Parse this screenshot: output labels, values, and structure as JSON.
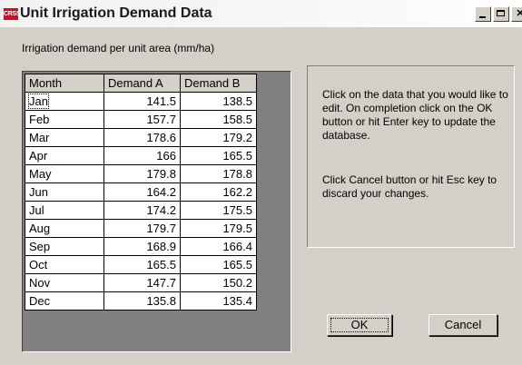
{
  "window": {
    "title": "Unit Irrigation Demand Data",
    "app_icon_text": "CRSS",
    "controls": [
      "minimize",
      "maximize",
      "close"
    ]
  },
  "caption": "Irrigation demand per unit area (mm/ha)",
  "table": {
    "headers": [
      "Month",
      "Demand A",
      "Demand B"
    ],
    "rows": [
      {
        "month": "Jan",
        "a": "141.5",
        "b": "138.5"
      },
      {
        "month": "Feb",
        "a": "157.7",
        "b": "158.5"
      },
      {
        "month": "Mar",
        "a": "178.6",
        "b": "179.2"
      },
      {
        "month": "Apr",
        "a": "166",
        "b": "165.5"
      },
      {
        "month": "May",
        "a": "179.8",
        "b": "178.8"
      },
      {
        "month": "Jun",
        "a": "164.2",
        "b": "162.2"
      },
      {
        "month": "Jul",
        "a": "174.2",
        "b": "175.5"
      },
      {
        "month": "Aug",
        "a": "179.7",
        "b": "179.5"
      },
      {
        "month": "Sep",
        "a": "168.9",
        "b": "166.4"
      },
      {
        "month": "Oct",
        "a": "165.5",
        "b": "165.5"
      },
      {
        "month": "Nov",
        "a": "147.7",
        "b": "150.2"
      },
      {
        "month": "Dec",
        "a": "135.8",
        "b": "135.4"
      }
    ]
  },
  "info": {
    "paragraph1": "Click on the data that you would like to edit. On completion click on the OK button or hit Enter key to update the database.",
    "paragraph2": "Click Cancel button or hit Esc key to discard your changes."
  },
  "buttons": {
    "ok": "OK",
    "cancel": "Cancel"
  },
  "icons": {
    "close": "close-icon",
    "minimize": "minimize-icon",
    "maximize": "maximize-icon"
  }
}
